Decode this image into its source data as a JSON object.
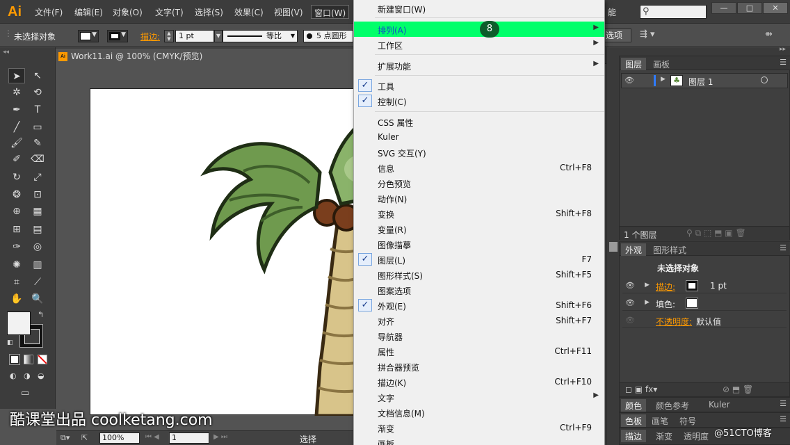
{
  "app": {
    "logo": "Ai"
  },
  "menubar": {
    "items": [
      "文件(F)",
      "编辑(E)",
      "对象(O)",
      "文字(T)",
      "选择(S)",
      "效果(C)",
      "视图(V)",
      "窗口(W)"
    ],
    "right_partial": "能",
    "window_buttons": [
      "—",
      "□",
      "✕"
    ]
  },
  "control": {
    "no_selection": "未选择对象",
    "stroke_label": "描边:",
    "stroke_value": "1 pt",
    "line_style": "等比",
    "brush": "5 点圆形",
    "options_partial": "选项"
  },
  "document": {
    "tab_title": "Work11.ai @ 100% (CMYK/预览)"
  },
  "status": {
    "zoom": "100%",
    "page": "1",
    "mode": "选择"
  },
  "menu": {
    "items": [
      {
        "label": "新建窗口(W)",
        "shortcut": "",
        "arrow": false,
        "checked": false
      },
      {
        "label": "排列(A)",
        "shortcut": "",
        "arrow": true,
        "checked": false,
        "highlight": true
      },
      {
        "label": "工作区",
        "shortcut": "",
        "arrow": true,
        "checked": false
      },
      {
        "label": "扩展功能",
        "shortcut": "",
        "arrow": true,
        "checked": false
      },
      {
        "label": "工具",
        "shortcut": "",
        "arrow": false,
        "checked": true
      },
      {
        "label": "控制(C)",
        "shortcut": "",
        "arrow": false,
        "checked": true
      },
      {
        "label": "CSS 属性",
        "shortcut": "",
        "arrow": false,
        "checked": false
      },
      {
        "label": "Kuler",
        "shortcut": "",
        "arrow": false,
        "checked": false
      },
      {
        "label": "SVG 交互(Y)",
        "shortcut": "",
        "arrow": false,
        "checked": false
      },
      {
        "label": "信息",
        "shortcut": "Ctrl+F8",
        "arrow": false,
        "checked": false
      },
      {
        "label": "分色预览",
        "shortcut": "",
        "arrow": false,
        "checked": false
      },
      {
        "label": "动作(N)",
        "shortcut": "",
        "arrow": false,
        "checked": false
      },
      {
        "label": "变换",
        "shortcut": "Shift+F8",
        "arrow": false,
        "checked": false
      },
      {
        "label": "变量(R)",
        "shortcut": "",
        "arrow": false,
        "checked": false
      },
      {
        "label": "图像描摹",
        "shortcut": "",
        "arrow": false,
        "checked": false
      },
      {
        "label": "图层(L)",
        "shortcut": "F7",
        "arrow": false,
        "checked": true
      },
      {
        "label": "图形样式(S)",
        "shortcut": "Shift+F5",
        "arrow": false,
        "checked": false
      },
      {
        "label": "图案选项",
        "shortcut": "",
        "arrow": false,
        "checked": false
      },
      {
        "label": "外观(E)",
        "shortcut": "Shift+F6",
        "arrow": false,
        "checked": true
      },
      {
        "label": "对齐",
        "shortcut": "Shift+F7",
        "arrow": false,
        "checked": false
      },
      {
        "label": "导航器",
        "shortcut": "",
        "arrow": false,
        "checked": false
      },
      {
        "label": "属性",
        "shortcut": "Ctrl+F11",
        "arrow": false,
        "checked": false
      },
      {
        "label": "拼合器预览",
        "shortcut": "",
        "arrow": false,
        "checked": false
      },
      {
        "label": "描边(K)",
        "shortcut": "Ctrl+F10",
        "arrow": false,
        "checked": false
      },
      {
        "label": "文字",
        "shortcut": "",
        "arrow": true,
        "checked": false
      },
      {
        "label": "文档信息(M)",
        "shortcut": "",
        "arrow": false,
        "checked": false
      },
      {
        "label": "渐变",
        "shortcut": "Ctrl+F9",
        "arrow": false,
        "checked": false
      },
      {
        "label": "画板",
        "shortcut": "",
        "arrow": false,
        "checked": false
      }
    ],
    "step_badge": "8"
  },
  "layers_panel": {
    "tabs": [
      "图层",
      "画板"
    ],
    "layer_name": "图层 1",
    "count": "1 个图层"
  },
  "appearance_panel": {
    "tabs": [
      "外观",
      "图形样式"
    ],
    "title": "未选择对象",
    "stroke_label": "描边:",
    "stroke_value": "1 pt",
    "fill_label": "填色:",
    "opacity_label": "不透明度:",
    "opacity_value": "默认值"
  },
  "color_panel": {
    "tabs": [
      "颜色",
      "颜色参考",
      "Kuler"
    ]
  },
  "swatch_panel": {
    "tabs": [
      "色板",
      "画笔",
      "符号"
    ]
  },
  "stroke_panel": {
    "tabs": [
      "描边",
      "渐变",
      "透明度"
    ]
  },
  "watermark": {
    "left": "酷课堂出品 coolketang.com",
    "right": "@51CTO博客"
  },
  "colors": {
    "highlight": "#00ff6a",
    "accent": "#ff9a00",
    "step_badge": "#0d5d2b"
  }
}
